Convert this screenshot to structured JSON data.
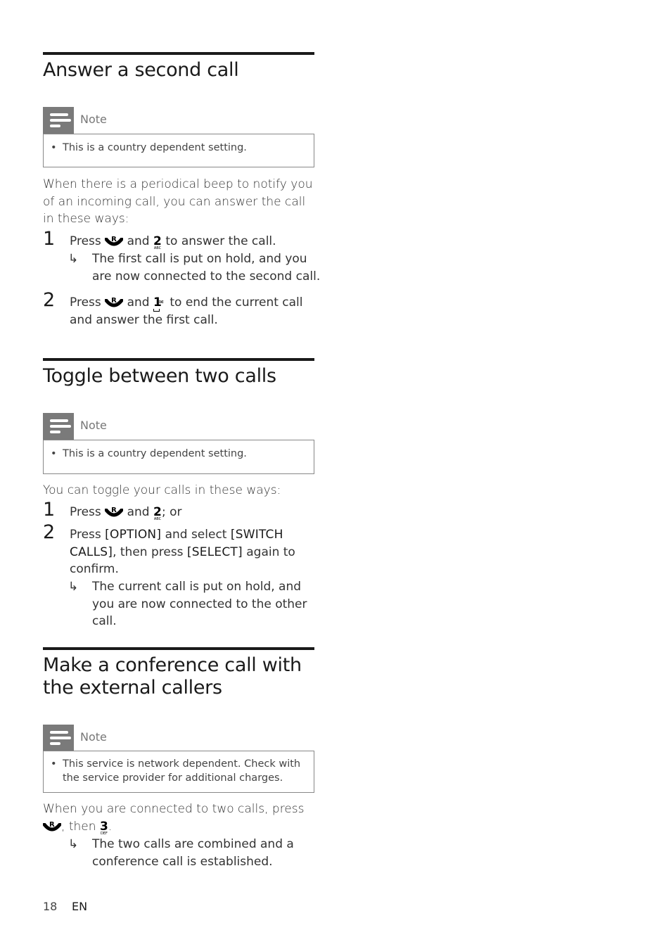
{
  "sections": [
    {
      "title": "Answer a second call",
      "note_label": "Note",
      "note_items": [
        "This is a country dependent setting."
      ],
      "intro": "When there is a periodical beep to notify you of an incoming call, you can answer the call in these ways:",
      "steps": [
        {
          "num": "1",
          "parts": [
            "Press",
            "and",
            "to answer the call."
          ],
          "key_number": "2",
          "key_sub": "ABC",
          "result": "The first call is put on hold, and you are now connected to the second call."
        },
        {
          "num": "2",
          "parts": [
            "Press",
            "and",
            "to end the current call and answer the first call."
          ],
          "key_number": "1",
          "key_sub": "✉"
        }
      ]
    },
    {
      "title": "Toggle between two calls",
      "note_label": "Note",
      "note_items": [
        "This is a country dependent setting."
      ],
      "intro": "You can toggle your calls in these ways:",
      "steps": [
        {
          "num": "1",
          "parts": [
            "Press",
            "and",
            "; or"
          ],
          "key_number": "2",
          "key_sub": "ABC"
        },
        {
          "num": "2",
          "parts": [
            "Press",
            "[OPTION]",
            "and select",
            "[SWITCH CALLS]",
            ", then press",
            "[SELECT]",
            "again to confirm."
          ],
          "result": "The current call is put on hold, and you are now connected to the other call."
        }
      ]
    },
    {
      "title_line1": "Make a conference call with",
      "title_line2": "the external callers",
      "note_label": "Note",
      "note_items": [
        "This service is network dependent. Check with the service provider for additional charges."
      ],
      "intro_parts": [
        "When you are connected to two calls, press",
        ",",
        "then",
        "."
      ],
      "key_number": "3",
      "key_sub": "DEF",
      "result": "The two calls are combined and a conference call is established."
    }
  ],
  "icons": {
    "recall_key_label": "R",
    "result_arrow": "↳",
    "note_icon": "note-icon"
  },
  "footer": {
    "page_number": "18",
    "language": "EN"
  }
}
